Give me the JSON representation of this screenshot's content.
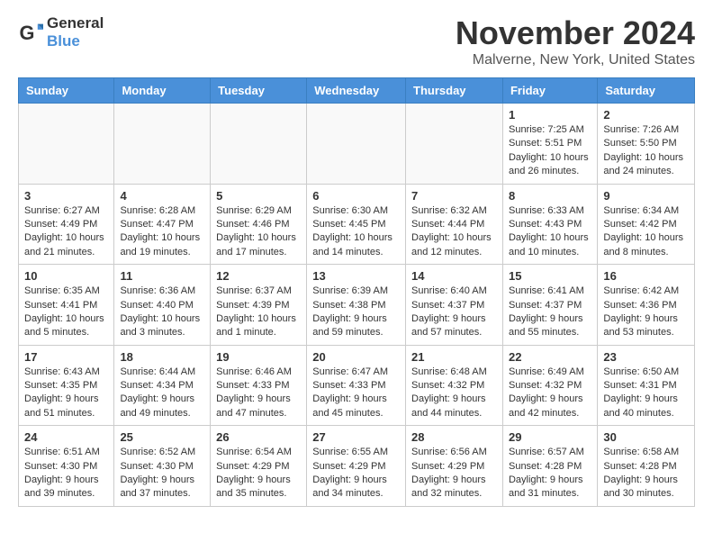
{
  "logo": {
    "general": "General",
    "blue": "Blue"
  },
  "header": {
    "month": "November 2024",
    "location": "Malverne, New York, United States"
  },
  "weekdays": [
    "Sunday",
    "Monday",
    "Tuesday",
    "Wednesday",
    "Thursday",
    "Friday",
    "Saturday"
  ],
  "weeks": [
    [
      {
        "day": "",
        "info": ""
      },
      {
        "day": "",
        "info": ""
      },
      {
        "day": "",
        "info": ""
      },
      {
        "day": "",
        "info": ""
      },
      {
        "day": "",
        "info": ""
      },
      {
        "day": "1",
        "info": "Sunrise: 7:25 AM\nSunset: 5:51 PM\nDaylight: 10 hours\nand 26 minutes."
      },
      {
        "day": "2",
        "info": "Sunrise: 7:26 AM\nSunset: 5:50 PM\nDaylight: 10 hours\nand 24 minutes."
      }
    ],
    [
      {
        "day": "3",
        "info": "Sunrise: 6:27 AM\nSunset: 4:49 PM\nDaylight: 10 hours\nand 21 minutes."
      },
      {
        "day": "4",
        "info": "Sunrise: 6:28 AM\nSunset: 4:47 PM\nDaylight: 10 hours\nand 19 minutes."
      },
      {
        "day": "5",
        "info": "Sunrise: 6:29 AM\nSunset: 4:46 PM\nDaylight: 10 hours\nand 17 minutes."
      },
      {
        "day": "6",
        "info": "Sunrise: 6:30 AM\nSunset: 4:45 PM\nDaylight: 10 hours\nand 14 minutes."
      },
      {
        "day": "7",
        "info": "Sunrise: 6:32 AM\nSunset: 4:44 PM\nDaylight: 10 hours\nand 12 minutes."
      },
      {
        "day": "8",
        "info": "Sunrise: 6:33 AM\nSunset: 4:43 PM\nDaylight: 10 hours\nand 10 minutes."
      },
      {
        "day": "9",
        "info": "Sunrise: 6:34 AM\nSunset: 4:42 PM\nDaylight: 10 hours\nand 8 minutes."
      }
    ],
    [
      {
        "day": "10",
        "info": "Sunrise: 6:35 AM\nSunset: 4:41 PM\nDaylight: 10 hours\nand 5 minutes."
      },
      {
        "day": "11",
        "info": "Sunrise: 6:36 AM\nSunset: 4:40 PM\nDaylight: 10 hours\nand 3 minutes."
      },
      {
        "day": "12",
        "info": "Sunrise: 6:37 AM\nSunset: 4:39 PM\nDaylight: 10 hours\nand 1 minute."
      },
      {
        "day": "13",
        "info": "Sunrise: 6:39 AM\nSunset: 4:38 PM\nDaylight: 9 hours\nand 59 minutes."
      },
      {
        "day": "14",
        "info": "Sunrise: 6:40 AM\nSunset: 4:37 PM\nDaylight: 9 hours\nand 57 minutes."
      },
      {
        "day": "15",
        "info": "Sunrise: 6:41 AM\nSunset: 4:37 PM\nDaylight: 9 hours\nand 55 minutes."
      },
      {
        "day": "16",
        "info": "Sunrise: 6:42 AM\nSunset: 4:36 PM\nDaylight: 9 hours\nand 53 minutes."
      }
    ],
    [
      {
        "day": "17",
        "info": "Sunrise: 6:43 AM\nSunset: 4:35 PM\nDaylight: 9 hours\nand 51 minutes."
      },
      {
        "day": "18",
        "info": "Sunrise: 6:44 AM\nSunset: 4:34 PM\nDaylight: 9 hours\nand 49 minutes."
      },
      {
        "day": "19",
        "info": "Sunrise: 6:46 AM\nSunset: 4:33 PM\nDaylight: 9 hours\nand 47 minutes."
      },
      {
        "day": "20",
        "info": "Sunrise: 6:47 AM\nSunset: 4:33 PM\nDaylight: 9 hours\nand 45 minutes."
      },
      {
        "day": "21",
        "info": "Sunrise: 6:48 AM\nSunset: 4:32 PM\nDaylight: 9 hours\nand 44 minutes."
      },
      {
        "day": "22",
        "info": "Sunrise: 6:49 AM\nSunset: 4:32 PM\nDaylight: 9 hours\nand 42 minutes."
      },
      {
        "day": "23",
        "info": "Sunrise: 6:50 AM\nSunset: 4:31 PM\nDaylight: 9 hours\nand 40 minutes."
      }
    ],
    [
      {
        "day": "24",
        "info": "Sunrise: 6:51 AM\nSunset: 4:30 PM\nDaylight: 9 hours\nand 39 minutes."
      },
      {
        "day": "25",
        "info": "Sunrise: 6:52 AM\nSunset: 4:30 PM\nDaylight: 9 hours\nand 37 minutes."
      },
      {
        "day": "26",
        "info": "Sunrise: 6:54 AM\nSunset: 4:29 PM\nDaylight: 9 hours\nand 35 minutes."
      },
      {
        "day": "27",
        "info": "Sunrise: 6:55 AM\nSunset: 4:29 PM\nDaylight: 9 hours\nand 34 minutes."
      },
      {
        "day": "28",
        "info": "Sunrise: 6:56 AM\nSunset: 4:29 PM\nDaylight: 9 hours\nand 32 minutes."
      },
      {
        "day": "29",
        "info": "Sunrise: 6:57 AM\nSunset: 4:28 PM\nDaylight: 9 hours\nand 31 minutes."
      },
      {
        "day": "30",
        "info": "Sunrise: 6:58 AM\nSunset: 4:28 PM\nDaylight: 9 hours\nand 30 minutes."
      }
    ]
  ]
}
